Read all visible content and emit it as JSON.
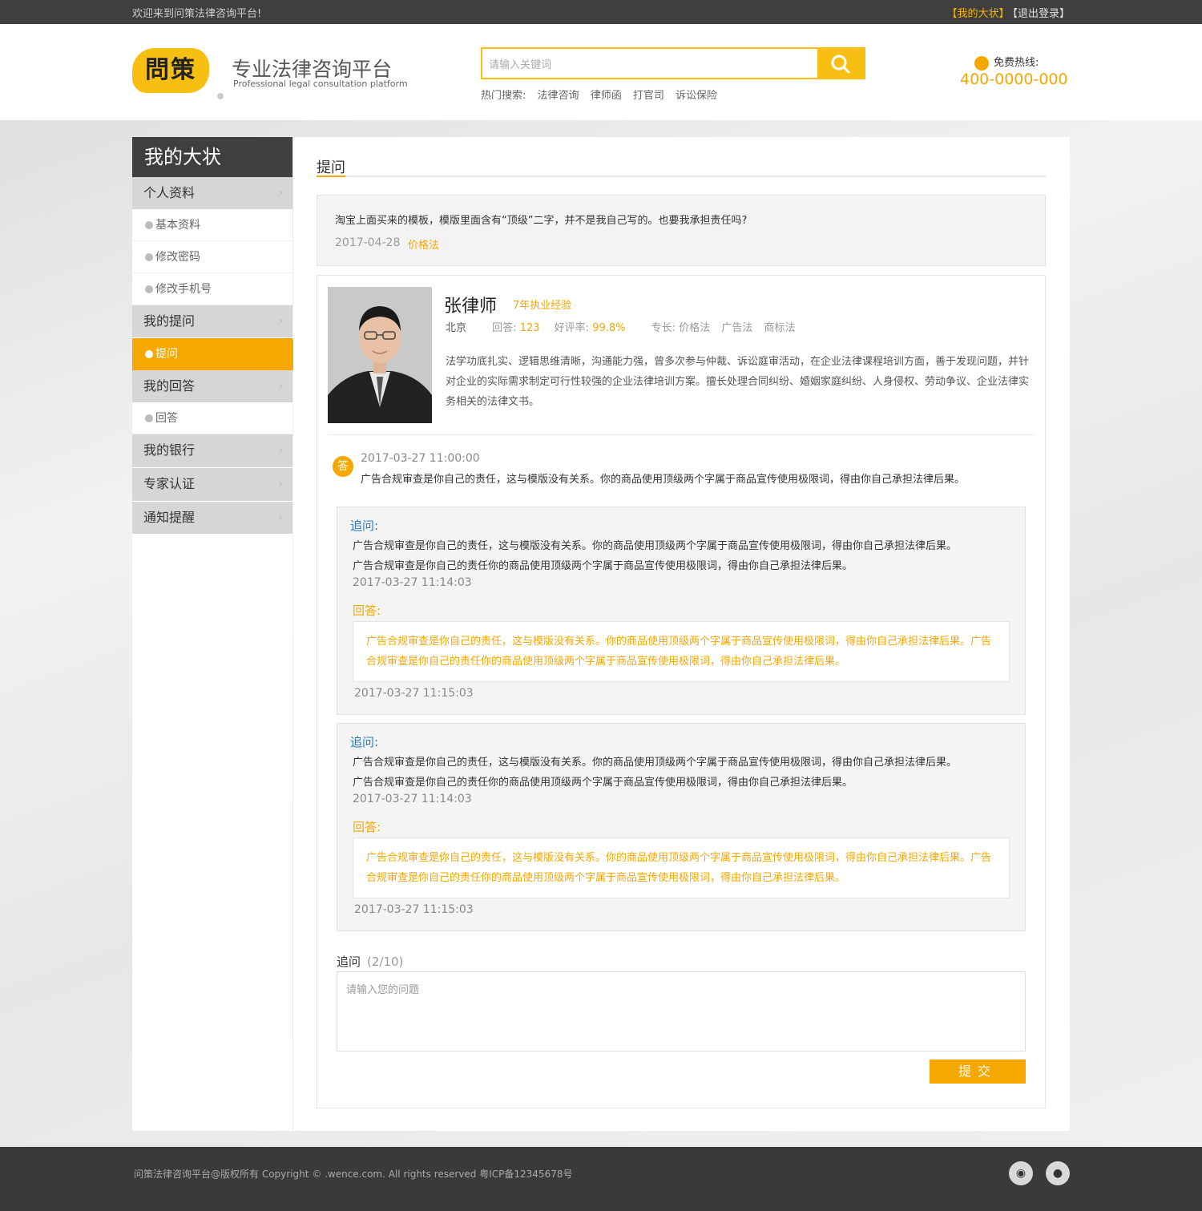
{
  "topbar": {
    "welcome": "欢迎来到问策法律咨询平台!",
    "my_link": "【我的大状】",
    "logout": "【退出登录】"
  },
  "header": {
    "logo_text": "問策",
    "slogan_cn": "专业法律咨询平台",
    "slogan_en": "Professional legal consultation platform",
    "search_placeholder": "请输入关键词",
    "hot_label": "热门搜索:",
    "hot_items": [
      "法律咨询",
      "律师函",
      "打官司",
      "诉讼保险"
    ],
    "hotline_label": "免费热线:",
    "hotline_number": "400-0000-000",
    "icons": {
      "search": "search-icon",
      "phone": "phone-icon"
    }
  },
  "sidebar": {
    "title": "我的大状",
    "groups": [
      {
        "label": "个人资料",
        "subs": [
          "基本资料",
          "修改密码",
          "修改手机号"
        ]
      },
      {
        "label": "我的提问",
        "subs": [
          "提问"
        ]
      },
      {
        "label": "我的回答",
        "subs": [
          "回答"
        ]
      },
      {
        "label": "我的银行",
        "subs": []
      },
      {
        "label": "专家认证",
        "subs": []
      },
      {
        "label": "通知提醒",
        "subs": []
      }
    ],
    "active": "提问",
    "chevron": "›"
  },
  "content": {
    "title": "提问",
    "question": {
      "text": "淘宝上面买来的模板，模版里面含有“顶级”二字，并不是我自己写的。也要我承担责任吗?",
      "date": "2017-04-28",
      "tag": "价格法"
    },
    "lawyer": {
      "name": "张律师",
      "experience": "7年执业经验",
      "city": "北京",
      "answers_label": "回答:",
      "answers_value": "123",
      "rating_label": "好评率:",
      "rating_value": "99.8%",
      "specialty_label": "专长:",
      "specialties": [
        "价格法",
        "广告法",
        "商标法"
      ],
      "description": "法学功底扎实、逻辑思维清晰，沟通能力强，曾多次参与仲裁、诉讼庭审活动，在企业法律课程培训方面，善于发现问题，并针对企业的实际需求制定可行性较强的企业法律培训方案。擅长处理合同纠纷、婚姻家庭纠纷、人身侵权、劳动争议、企业法律实务相关的法律文书。"
    },
    "answer": {
      "badge": "答",
      "date": "2017-03-27 11:00:00",
      "text": "广告合规审查是你自己的责任，这与模版没有关系。你的商品使用顶级两个字属于商品宣传使用极限词，得由你自己承担法律后果。"
    },
    "followups": [
      {
        "label": "追问:",
        "line1": "广告合规审查是你自己的责任，这与模版没有关系。你的商品使用顶级两个字属于商品宣传使用极限词，得由你自己承担法律后果。",
        "line2": "广告合规审查是你自己的责任你的商品使用顶级两个字属于商品宣传使用极限词，得由你自己承担法律后果。",
        "date": "2017-03-27 11:14:03",
        "reply_label": "回答:",
        "reply": "广告合规审查是你自己的责任，这与模版没有关系。你的商品使用顶级两个字属于商品宣传使用极限词，得由你自己承担法律后果。广告合规审查是你自己的责任你的商品使用顶级两个字属于商品宣传使用极限词，得由你自己承担法律后果。",
        "reply_date": "2017-03-27 11:15:03"
      },
      {
        "label": "追问:",
        "line1": "广告合规审查是你自己的责任，这与模版没有关系。你的商品使用顶级两个字属于商品宣传使用极限词，得由你自己承担法律后果。",
        "line2": "广告合规审查是你自己的责任你的商品使用顶级两个字属于商品宣传使用极限词，得由你自己承担法律后果。",
        "date": "2017-03-27 11:14:03",
        "reply_label": "回答:",
        "reply": "广告合规审查是你自己的责任，这与模版没有关系。你的商品使用顶级两个字属于商品宣传使用极限词，得由你自己承担法律后果。广告合规审查是你自己的责任你的商品使用顶级两个字属于商品宣传使用极限词，得由你自己承担法律后果。",
        "reply_date": "2017-03-27 11:15:03"
      }
    ],
    "ask": {
      "label": "追问",
      "count": "(2/10)",
      "placeholder": "请输入您的问题",
      "submit": "提交"
    }
  },
  "footer": {
    "copyright": "问策法律咨询平台@版权所有  Copyright © .wence.com. All rights reserved  粤ICP备12345678号",
    "icons": [
      "weibo-icon",
      "wechat-icon"
    ]
  },
  "colors": {
    "accent": "#f6a700",
    "logo": "#f6bf12",
    "dark": "#3f3f3f",
    "link_blue": "#1e7bc8"
  }
}
